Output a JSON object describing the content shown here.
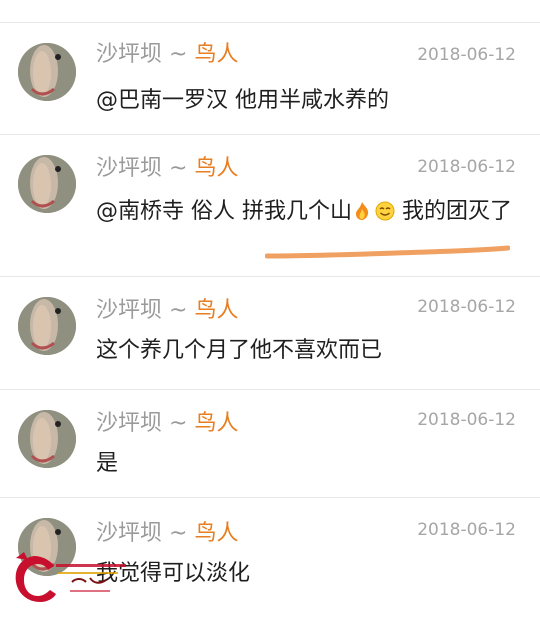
{
  "comments": [
    {
      "user": "沙坪坝",
      "separator": "~",
      "badge": "鸟人",
      "time": "2018-06-12",
      "text": "@巴南一罗汉 他用半咸水养的"
    },
    {
      "user": "沙坪坝",
      "separator": "~",
      "badge": "鸟人",
      "time": "2018-06-12",
      "text_part1": "@南桥寺   俗人 拼我几个山",
      "text_part2": " 我的团灭了",
      "emojis": [
        "fire-emoji",
        "smile-emoji"
      ]
    },
    {
      "user": "沙坪坝",
      "separator": "~",
      "badge": "鸟人",
      "time": "2018-06-12",
      "text": "这个养几个月了他不喜欢而已"
    },
    {
      "user": "沙坪坝",
      "separator": "~",
      "badge": "鸟人",
      "time": "2018-06-12",
      "text": "是"
    },
    {
      "user": "沙坪坝",
      "separator": "~",
      "badge": "鸟人",
      "time": "2018-06-12",
      "text": "我觉得可以淡化"
    }
  ],
  "annotation": {
    "type": "hand-drawn-underline",
    "color": "#f0a060"
  },
  "watermark": {
    "logo": "watermark-logo",
    "color": "#c8102e"
  }
}
